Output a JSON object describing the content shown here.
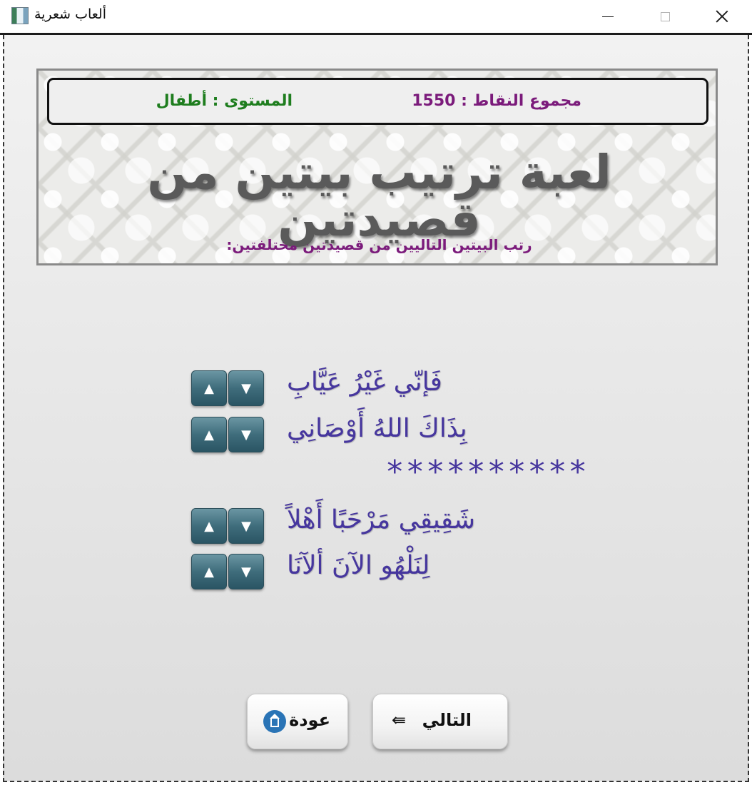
{
  "window": {
    "title": "ألعاب شعرية"
  },
  "header": {
    "score_text": "مجموع النقاط : 1550",
    "level_text": "المستوى : أطفال",
    "game_title": "لعبة ترتيب بيتين من قصيدتين",
    "instruction": "رتب البيتين التاليين من قصيدتين مختلفتين:"
  },
  "verses": [
    {
      "text": "فَإنّي غَيْرُ عَيَّابِ"
    },
    {
      "text": "بِذَاكَ اللهُ أَوْصَانِي"
    },
    {
      "text": "شَقِيقِي مَرْحَبًا أَهْلاً"
    },
    {
      "text": "لِنَلْهُو الآنَ ألآنَا"
    }
  ],
  "separator": "**********",
  "controls": {
    "up_glyph": "▲",
    "down_glyph": "▼",
    "back_label": "عودة",
    "next_label": "التالي",
    "next_arrow": "⇚"
  },
  "colors": {
    "score": "#7b1b7b",
    "level": "#1e7d1e",
    "verse": "#46369e",
    "button_teal": "#3f6d7c",
    "home_icon_blue": "#2a74b6"
  },
  "icons": [
    "app-icon",
    "minimize-icon",
    "maximize-icon",
    "close-icon",
    "home-icon",
    "arrow-left-icon",
    "arrow-up-icon",
    "arrow-down-icon"
  ]
}
